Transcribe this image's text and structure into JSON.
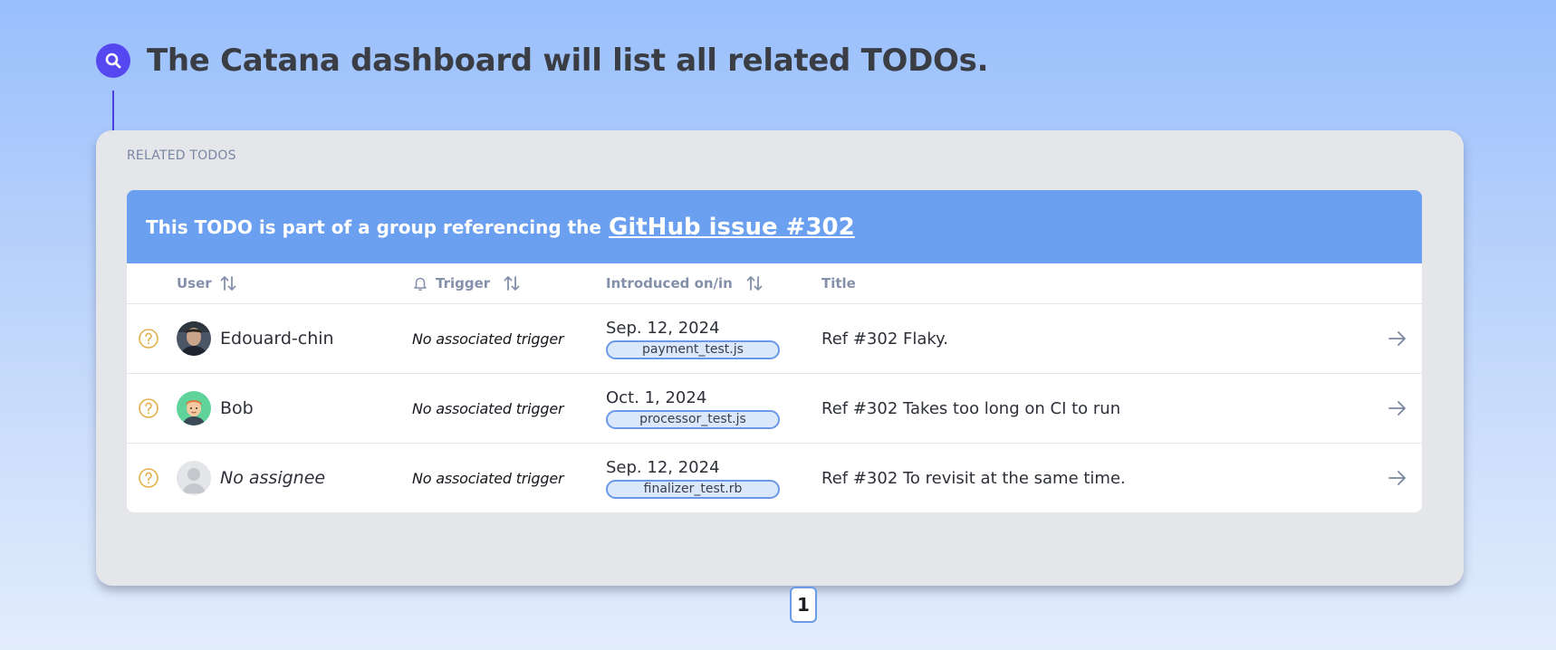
{
  "heading": {
    "icon": "search-icon",
    "text": "The Catana dashboard will list all related TODOs."
  },
  "card": {
    "label": "RELATED TODOS",
    "banner": {
      "prefix": "This TODO is part of a group referencing the",
      "link_text": "GitHub issue #302"
    },
    "columns": {
      "user": "User",
      "trigger": "Trigger",
      "introduced": "Introduced on/in",
      "title": "Title"
    },
    "rows": [
      {
        "status_icon": "question-circle-icon",
        "avatar": "avatar-photo",
        "user": "Edouard-chin",
        "trigger": "No associated trigger",
        "date": "Sep. 12, 2024",
        "file": "payment_test.js",
        "title": "Ref #302 Flaky."
      },
      {
        "status_icon": "question-circle-icon",
        "avatar": "avatar-cartoon",
        "user": "Bob",
        "trigger": "No associated trigger",
        "date": "Oct. 1, 2024",
        "file": "processor_test.js",
        "title": "Ref #302 Takes too long on CI to run"
      },
      {
        "status_icon": "question-circle-icon",
        "avatar": "avatar-placeholder",
        "user": "No assignee",
        "trigger": "No associated trigger",
        "date": "Sep. 12, 2024",
        "file": "finalizer_test.rb",
        "title": "Ref #302 To revisit at the same time."
      }
    ],
    "pagination": {
      "current_page": "1"
    }
  },
  "colors": {
    "accent": "#5548f0",
    "banner": "#6b9ff0",
    "badge_border": "#6a98e8",
    "status_icon": "#e2b04a"
  }
}
